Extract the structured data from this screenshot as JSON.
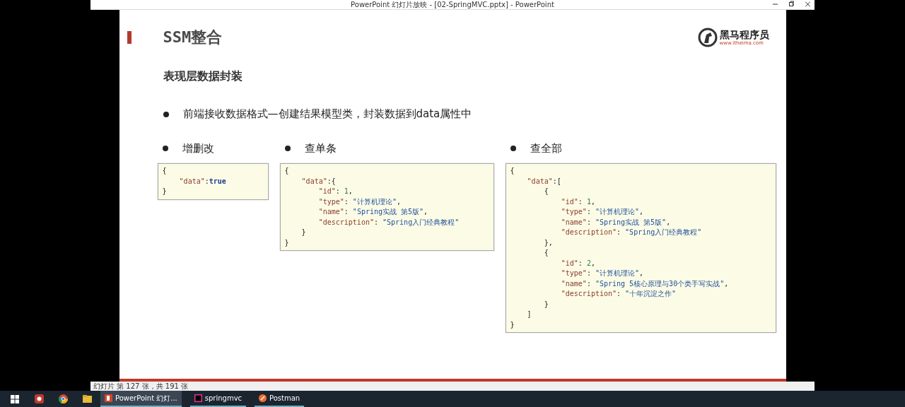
{
  "window": {
    "title": "PowerPoint 幻灯片放映 - [02-SpringMVC.pptx] - PowerPoint"
  },
  "slide": {
    "title": "SSM整合",
    "subtitle": "表现层数据封装",
    "bullet": "前端接收数据格式—创建结果模型类，封装数据到data属性中",
    "columns": [
      {
        "heading": "增删改",
        "code": [
          "{",
          "    \"data\":true",
          "}"
        ]
      },
      {
        "heading": "查单条",
        "code": [
          "{",
          "    \"data\":{",
          "        \"id\": 1,",
          "        \"type\": \"计算机理论\",",
          "        \"name\": \"Spring实战 第5版\",",
          "        \"description\": \"Spring入门经典教程\"",
          "    }",
          "}"
        ]
      },
      {
        "heading": "查全部",
        "code": [
          "{",
          "    \"data\":[",
          "        {",
          "            \"id\": 1,",
          "            \"type\": \"计算机理论\",",
          "            \"name\": \"Spring实战 第5版\",",
          "            \"description\": \"Spring入门经典教程\"",
          "        },",
          "        {",
          "            \"id\": 2,",
          "            \"type\": \"计算机理论\",",
          "            \"name\": \"Spring 5核心原理与30个类手写实战\",",
          "            \"description\": \"十年沉淀之作\"",
          "        }",
          "    ]",
          "}"
        ]
      }
    ],
    "logo": {
      "name": "黑马程序员",
      "url": "www.itheima.com"
    }
  },
  "status_bar": {
    "text": "幻灯片 第 127 张，共 191 张"
  },
  "taskbar": {
    "apps": [
      {
        "kind": "powerpoint",
        "label": "PowerPoint 幻灯...",
        "selected": true
      },
      {
        "kind": "idea",
        "label": "springmvc",
        "selected": false
      },
      {
        "kind": "postman",
        "label": "Postman",
        "selected": false
      }
    ]
  }
}
